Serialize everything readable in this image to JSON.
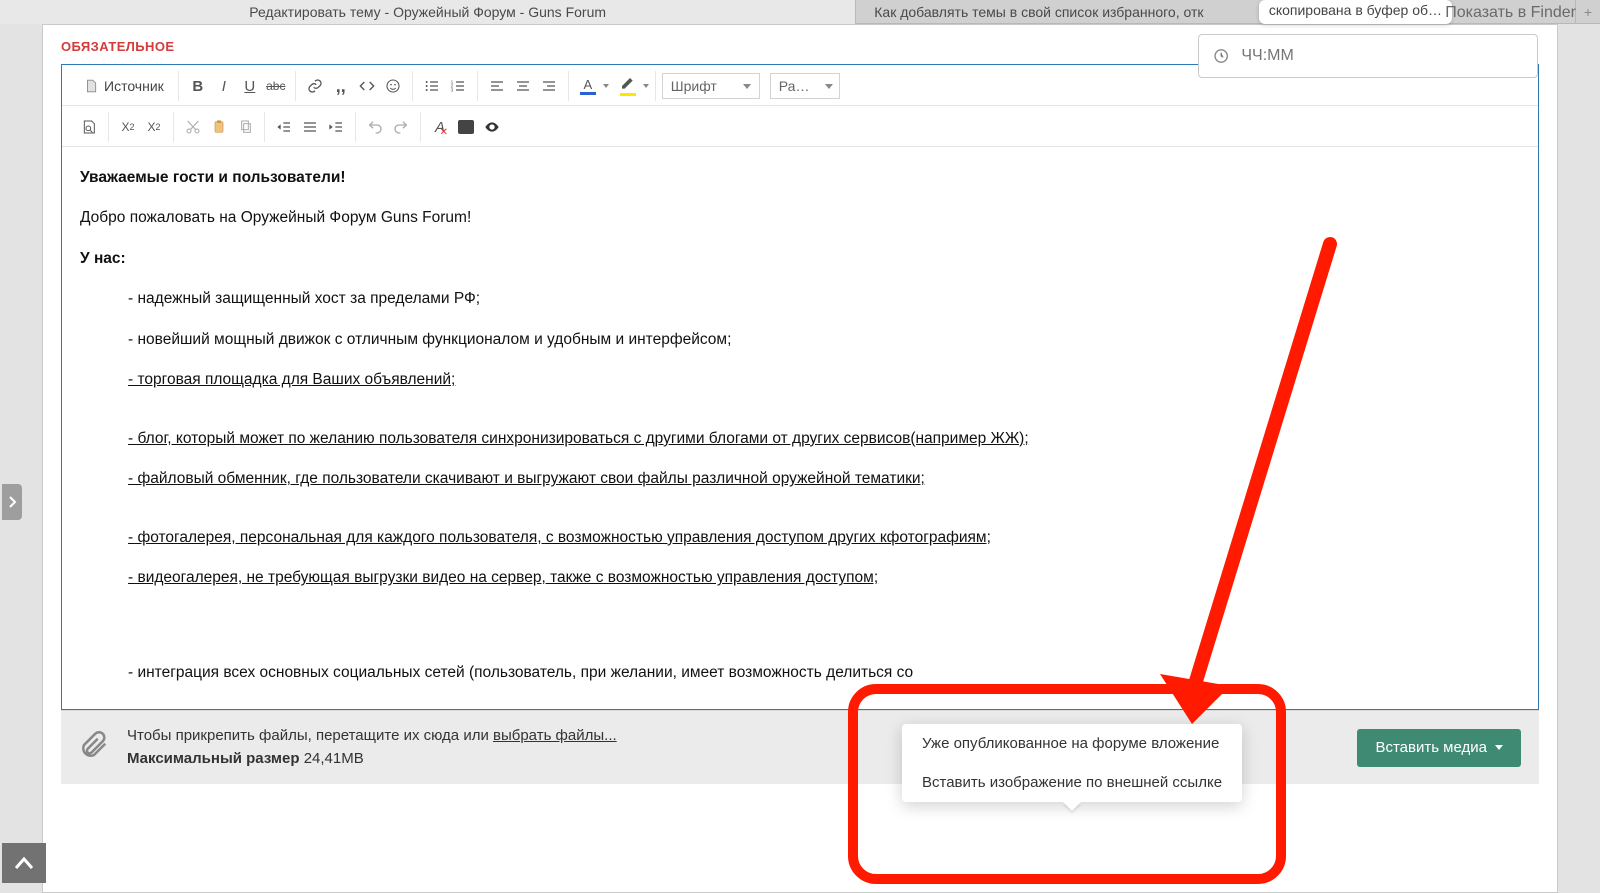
{
  "tabs": {
    "active": "Редактировать тему - Оружейный Форум - Guns Forum",
    "inactive": "Как добавлять темы в свой список избранного, отк"
  },
  "toast": "скопирована в буфер об…",
  "finder": "Показать в Finder",
  "required_label": "ОБЯЗАТЕЛЬНОЕ",
  "toolbar": {
    "source": "Источник",
    "font": "Шрифт",
    "size": "Ра…"
  },
  "document": {
    "greeting": "Уважаемые гости и пользователи!",
    "welcome": "Добро пожаловать на Оружейный Форум Guns Forum!",
    "we_have": "У нас:",
    "points": [
      "- надежный защищенный хост за пределами РФ;",
      "- новейший мощный движок с отличным функционалом и удобным и интерфейсом;",
      "- торговая площадка для Ваших объявлений;",
      "- блог, который может по желанию пользователя синхронизироваться с другими блогами от других сервисов(например ЖЖ);",
      "- файловый обменник, где пользователи скачивают и выгружают свои файлы различной оружейной тематики;",
      "- фотогалерея, персональная для каждого пользователя, с возможностью управления доступом других кфотографиям;",
      "- видеогалерея, не требующая выгрузки видео на сервер, также с возможностью управления доступом;",
      "- интеграция всех основных социальных сетей (пользователь, при желании, имеет возможность делиться со"
    ]
  },
  "attach": {
    "hint_prefix": "Чтобы прикрепить файлы, перетащите их сюда или ",
    "choose": "выбрать файлы...",
    "max_label": "Максимальный размер",
    "max_value": "24,41MB"
  },
  "media_btn": "Вставить медиа",
  "popover": {
    "item1": "Уже опубликованное на форуме вложение",
    "item2": "Вставить изображение по внешней ссылке"
  },
  "time_placeholder": "ЧЧ:ММ"
}
